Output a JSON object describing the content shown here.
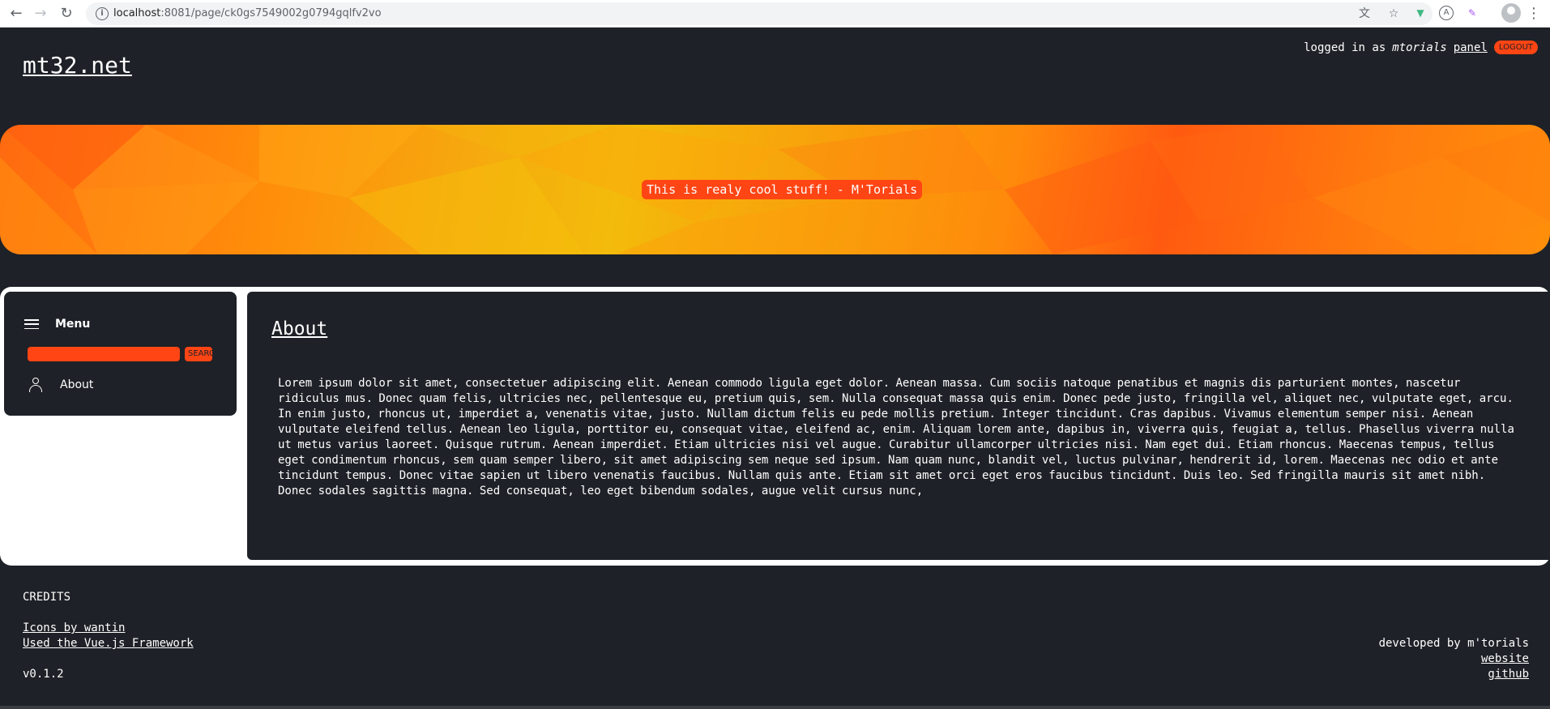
{
  "browser": {
    "url_host": "localhost",
    "url_rest": ":8081/page/ck0gs7549002g0794gqlfv2vo"
  },
  "header": {
    "site_title": "mt32.net",
    "logged_in_prefix": "logged in as",
    "username": "mtorials",
    "panel_link": "panel",
    "logout_label": "LOGOUT"
  },
  "banner": {
    "quote": "This is realy cool stuff! - M'Torials"
  },
  "sidebar": {
    "menu_label": "Menu",
    "search_placeholder": "",
    "search_button": "SEARCH",
    "items": [
      {
        "label": "About"
      }
    ]
  },
  "main": {
    "title": "About",
    "body": "Lorem ipsum dolor sit amet, consectetuer adipiscing elit. Aenean commodo ligula eget dolor. Aenean massa. Cum sociis natoque penatibus et magnis dis parturient montes, nascetur ridiculus mus. Donec quam felis, ultricies nec, pellentesque eu, pretium quis, sem. Nulla consequat massa quis enim. Donec pede justo, fringilla vel, aliquet nec, vulputate eget, arcu. In enim justo, rhoncus ut, imperdiet a, venenatis vitae, justo. Nullam dictum felis eu pede mollis pretium. Integer tincidunt. Cras dapibus. Vivamus elementum semper nisi. Aenean vulputate eleifend tellus. Aenean leo ligula, porttitor eu, consequat vitae, eleifend ac, enim. Aliquam lorem ante, dapibus in, viverra quis, feugiat a, tellus. Phasellus viverra nulla ut metus varius laoreet. Quisque rutrum. Aenean imperdiet. Etiam ultricies nisi vel augue. Curabitur ullamcorper ultricies nisi. Nam eget dui. Etiam rhoncus. Maecenas tempus, tellus eget condimentum rhoncus, sem quam semper libero, sit amet adipiscing sem neque sed ipsum. Nam quam nunc, blandit vel, luctus pulvinar, hendrerit id, lorem. Maecenas nec odio et ante tincidunt tempus. Donec vitae sapien ut libero venenatis faucibus. Nullam quis ante. Etiam sit amet orci eget eros faucibus tincidunt. Duis leo. Sed fringilla mauris sit amet nibh. Donec sodales sagittis magna. Sed consequat, leo eget bibendum sodales, augue velit cursus nunc,"
  },
  "footer": {
    "credits_title": "CREDITS",
    "icons_link": "Icons by wantin",
    "vue_link": "Used the Vue.js Framework",
    "version": "v0.1.2",
    "developed_by": "developed by m'torials",
    "website_link": "website",
    "github_link": "github"
  }
}
